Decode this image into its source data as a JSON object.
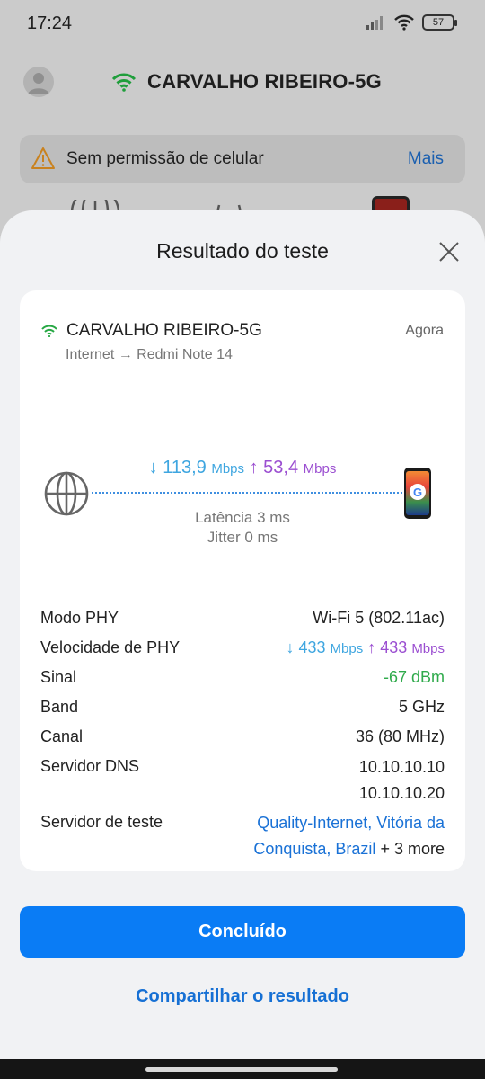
{
  "status_bar": {
    "time": "17:24",
    "battery": "57"
  },
  "background": {
    "network_name": "CARVALHO RIBEIRO-5G",
    "permission_text": "Sem permissão de celular",
    "more_label": "Mais"
  },
  "sheet": {
    "title": "Resultado do teste",
    "ssid": "CARVALHO RIBEIRO-5G",
    "time_label": "Agora",
    "route": "Internet → Redmi Note 14",
    "download_value": "↓ 113,9",
    "download_unit": "Mbps",
    "upload_value": "↑ 53,4",
    "upload_unit": "Mbps",
    "latency": "Latência 3 ms",
    "jitter": "Jitter 0 ms"
  },
  "details": {
    "phy_mode_label": "Modo PHY",
    "phy_mode_value": "Wi-Fi 5 (802.11ac)",
    "phy_speed_label": "Velocidade de PHY",
    "phy_speed_down": "↓ 433",
    "phy_speed_down_unit": "Mbps",
    "phy_speed_up": "↑ 433",
    "phy_speed_up_unit": "Mbps",
    "signal_label": "Sinal",
    "signal_value": "-67 dBm",
    "band_label": "Band",
    "band_value": "5 GHz",
    "channel_label": "Canal",
    "channel_value": "36 (80 MHz)",
    "dns_label": "Servidor DNS",
    "dns_primary": "10.10.10.10",
    "dns_secondary": "10.10.10.20",
    "test_server_label": "Servidor de teste",
    "test_server_line1": "Quality-Internet, Vitória da",
    "test_server_line2": "Conquista, Brazil",
    "test_server_more": "+ 3 more"
  },
  "actions": {
    "done_label": "Concluído",
    "share_label": "Compartilhar o resultado"
  },
  "colors": {
    "download": "#3fa6e0",
    "upload": "#9b4fd1",
    "signal_good": "#2faa4b",
    "primary_button": "#0a7cf5",
    "link": "#1971d6"
  },
  "icons": {
    "wifi": "wifi-icon",
    "globe": "globe-icon",
    "phone": "phone-icon",
    "close": "close-icon",
    "warning": "warning-icon"
  }
}
